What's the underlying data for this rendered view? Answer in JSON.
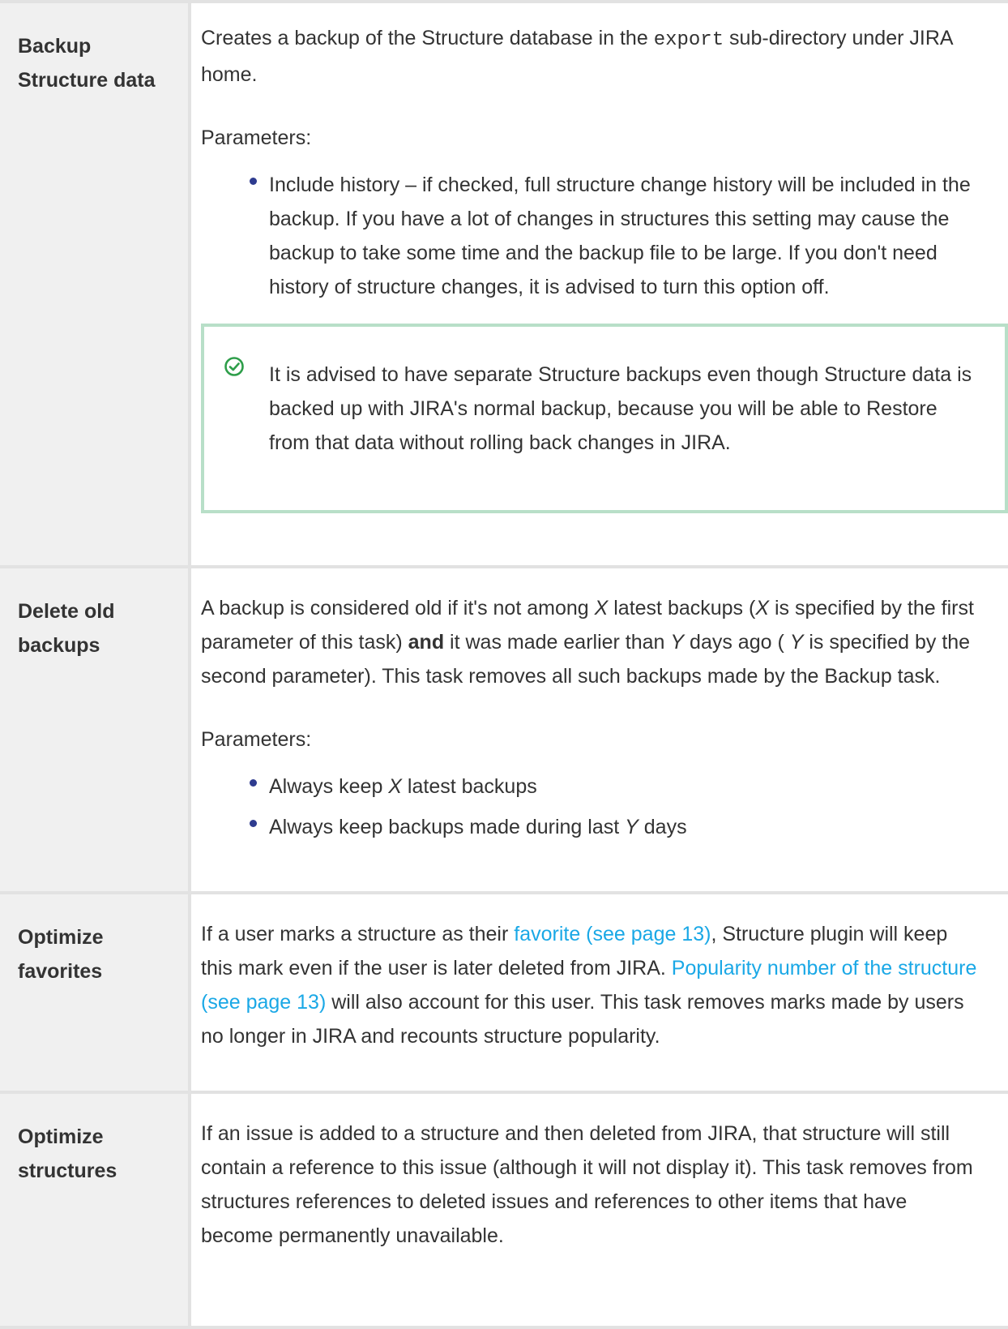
{
  "rows": [
    {
      "heading_line1": "Backup",
      "heading_line2": "Structure data",
      "p1_before": "Creates a backup of the Structure database in the ",
      "p1_code": "export",
      "p1_after": " sub-directory under JIRA home.",
      "params_label": "Parameters:",
      "bullet1": "Include history – if checked, full structure change history will be included in the backup. If you have a lot of changes in structures this setting may cause the backup to take some time and the backup file to be large. If you don't need history of structure changes, it is advised to turn this option off.",
      "tip_icon": "check-circle-icon",
      "tip_text": "It is advised to have separate Structure backups even though Structure data is backed up with JIRA's normal backup, because you will be able to Restore from that data without rolling back changes in JIRA."
    },
    {
      "heading_line1": "Delete old",
      "heading_line2": "backups",
      "p1_a": "A backup is considered old if it's not among ",
      "var_x": "X",
      "p1_b": " latest backups (",
      "p1_c": " is specified by the first parameter of this task) ",
      "p1_and": "and",
      "p1_d": " it was made earlier than ",
      "var_y": "Y",
      "p1_e": " days ago ( ",
      "p1_f": " is specified by the second parameter). This task removes all such backups made by the Backup task.",
      "params_label": "Parameters:",
      "bullet1_a": "Always keep ",
      "bullet1_b": " latest backups",
      "bullet2_a": "Always keep backups made during last ",
      "bullet2_b": " days"
    },
    {
      "heading_line1": "Optimize",
      "heading_line2": "favorites",
      "p1_a": "If a user marks a structure as their ",
      "link1": "favorite (see page 13)",
      "p1_b": ", Structure plugin will keep this mark even if the user is later deleted from JIRA. ",
      "link2": "Popularity number of the structure (see page 13)",
      "p1_c": " will also account for this user. This task removes marks made by users no longer in JIRA and recounts structure popularity."
    },
    {
      "heading_line1": "Optimize",
      "heading_line2": "structures",
      "p1": "If an issue is added to a structure and then deleted from JIRA, that structure will still contain a reference to this issue (although it will not display it). This task removes from structures references to deleted issues and references to other items that have become permanently unavailable."
    }
  ],
  "colors": {
    "link": "#1aa8e6",
    "bullet": "#2e3b8f",
    "tip_border": "#b8dfc8",
    "tip_icon": "#2e9e4a",
    "header_bg": "#f0f0f0",
    "border": "#e2e2e2"
  }
}
